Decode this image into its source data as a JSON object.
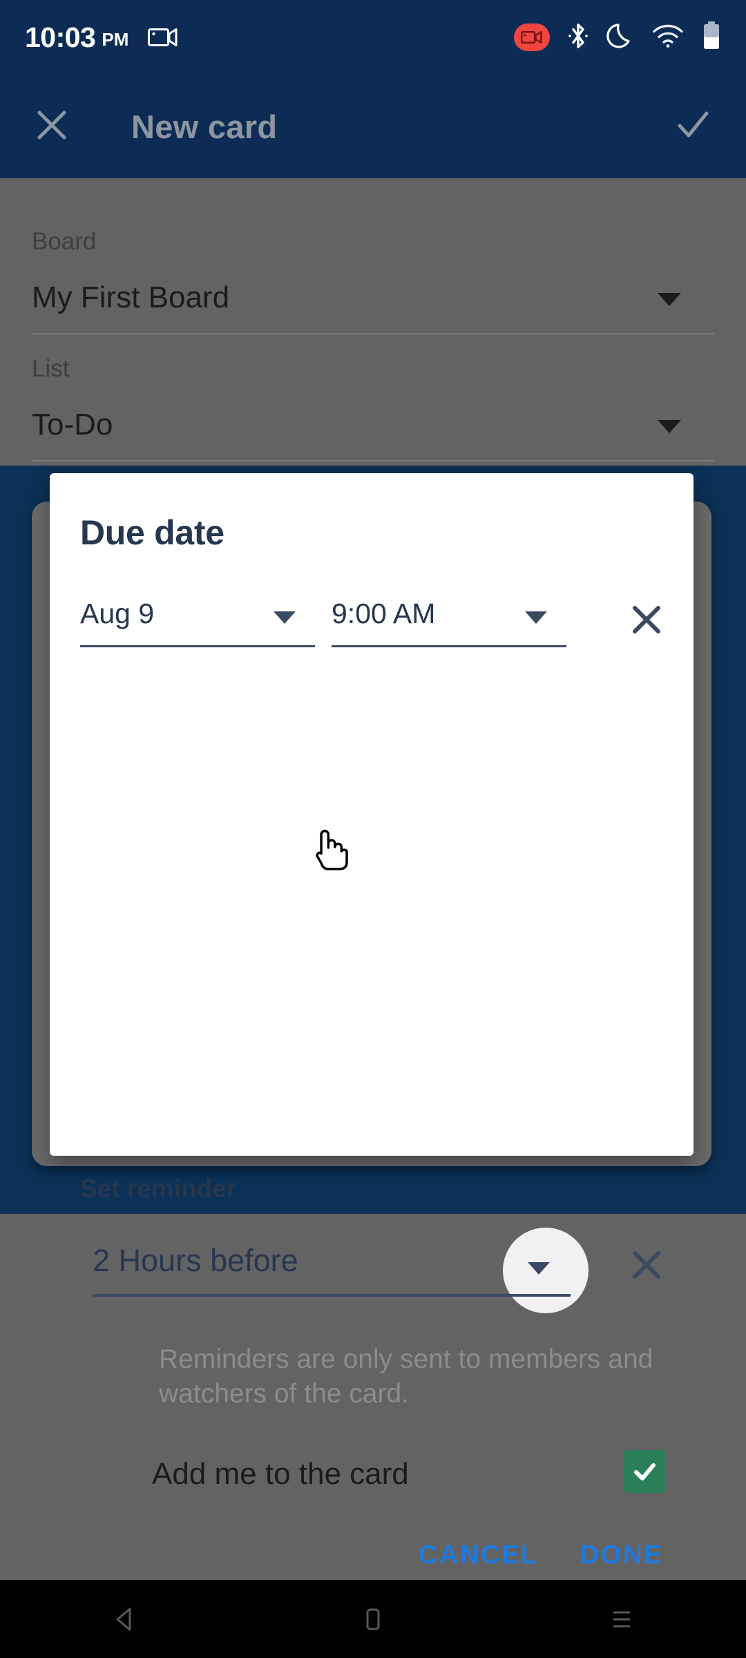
{
  "statusbar": {
    "time": "10:03",
    "ampm": "PM",
    "icons": [
      "screen-record-camcorder-icon",
      "screen-record-badge-icon",
      "bluetooth-icon",
      "do-not-disturb-moon-icon",
      "wifi-icon",
      "battery-icon"
    ]
  },
  "appbar": {
    "title": "New card",
    "close_icon": "close-icon",
    "confirm_icon": "check-icon"
  },
  "form": {
    "board_label": "Board",
    "board_value": "My First Board",
    "list_label": "List",
    "list_value": "To-Do"
  },
  "dialog": {
    "title": "Due date",
    "date_value": "Aug 9",
    "time_value": "9:00 AM",
    "clear_due_icon": "close-icon",
    "reminder_label": "Set reminder",
    "reminder_value": "2 Hours before",
    "clear_reminder_icon": "close-icon",
    "helper_text": "Reminders are only sent to members and watchers of the card.",
    "addme_label": "Add me to the card",
    "addme_checked": true,
    "cancel_label": "CANCEL",
    "done_label": "DONE"
  },
  "navbar": {
    "back_icon": "back-triangle-icon",
    "home_icon": "home-square-icon",
    "recents_icon": "recents-menu-icon"
  },
  "colors": {
    "appbar_bg": "#0d2c55",
    "navy_band": "#0b3157",
    "scrim": "#636363",
    "accent_blue": "#1d7ae0",
    "title_navy": "#26374f",
    "checkbox_green": "#2a8159",
    "record_red": "#f0463f"
  }
}
